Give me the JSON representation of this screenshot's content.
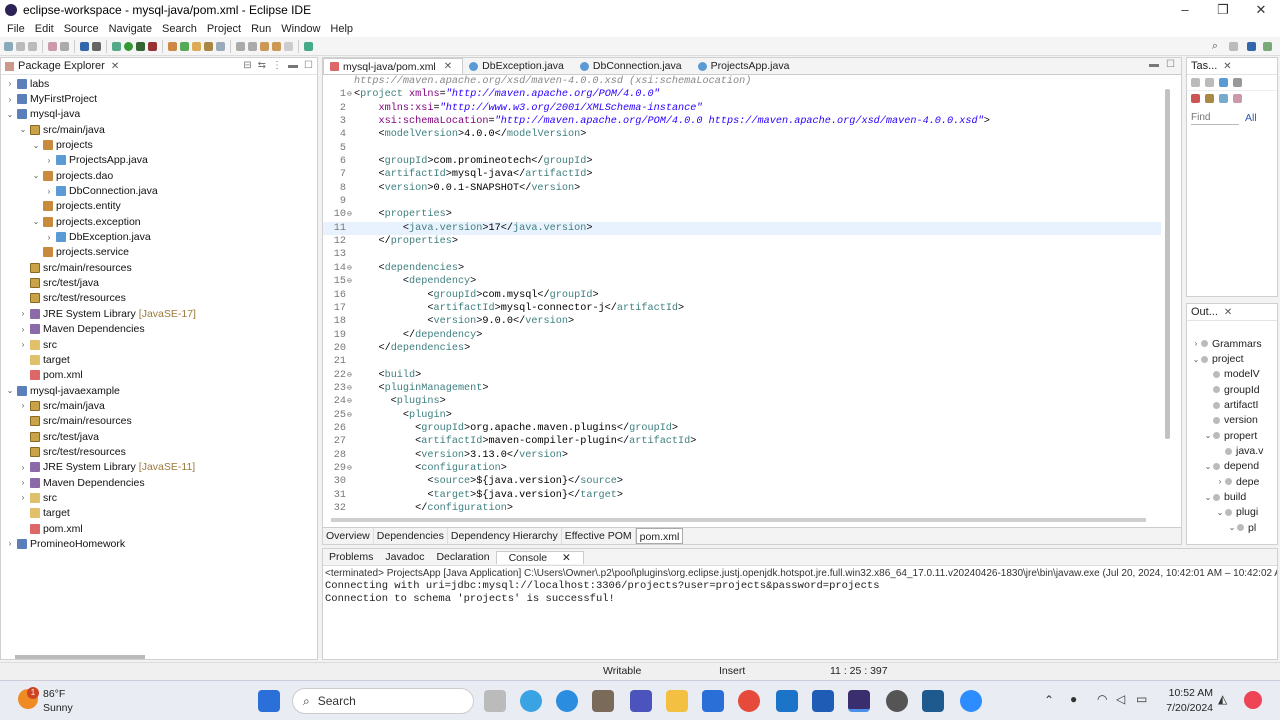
{
  "window": {
    "title": "eclipse-workspace - mysql-java/pom.xml - Eclipse IDE",
    "buttons": [
      "–",
      "❐",
      "✕"
    ]
  },
  "menu": [
    "File",
    "Edit",
    "Source",
    "Navigate",
    "Search",
    "Project",
    "Run",
    "Window",
    "Help"
  ],
  "explorer": {
    "title": "Package Explorer",
    "items": [
      {
        "label": "labs",
        "depth": 0,
        "expand": ">",
        "icon": "project"
      },
      {
        "label": "MyFirstProject",
        "depth": 0,
        "expand": ">",
        "icon": "project"
      },
      {
        "label": "mysql-java",
        "depth": 0,
        "expand": "v",
        "icon": "project"
      },
      {
        "label": "src/main/java",
        "depth": 1,
        "expand": "v",
        "icon": "src-folder"
      },
      {
        "label": "projects",
        "depth": 2,
        "expand": "v",
        "icon": "package"
      },
      {
        "label": "ProjectsApp.java",
        "depth": 3,
        "expand": ">",
        "icon": "java-file"
      },
      {
        "label": "projects.dao",
        "depth": 2,
        "expand": "v",
        "icon": "package"
      },
      {
        "label": "DbConnection.java",
        "depth": 3,
        "expand": ">",
        "icon": "java-file"
      },
      {
        "label": "projects.entity",
        "depth": 2,
        "expand": "",
        "icon": "package"
      },
      {
        "label": "projects.exception",
        "depth": 2,
        "expand": "v",
        "icon": "package"
      },
      {
        "label": "DbException.java",
        "depth": 3,
        "expand": ">",
        "icon": "java-file"
      },
      {
        "label": "projects.service",
        "depth": 2,
        "expand": "",
        "icon": "package"
      },
      {
        "label": "src/main/resources",
        "depth": 1,
        "expand": "",
        "icon": "src-folder"
      },
      {
        "label": "src/test/java",
        "depth": 1,
        "expand": "",
        "icon": "src-folder"
      },
      {
        "label": "src/test/resources",
        "depth": 1,
        "expand": "",
        "icon": "src-folder"
      },
      {
        "label": "JRE System Library",
        "decor": "[JavaSE-17]",
        "depth": 1,
        "expand": ">",
        "icon": "library"
      },
      {
        "label": "Maven Dependencies",
        "depth": 1,
        "expand": ">",
        "icon": "library"
      },
      {
        "label": "src",
        "depth": 1,
        "expand": ">",
        "icon": "folder"
      },
      {
        "label": "target",
        "depth": 1,
        "expand": "",
        "icon": "folder"
      },
      {
        "label": "pom.xml",
        "depth": 1,
        "expand": "",
        "icon": "xml-file"
      },
      {
        "label": "mysql-javaexample",
        "depth": 0,
        "expand": "v",
        "icon": "project"
      },
      {
        "label": "src/main/java",
        "depth": 1,
        "expand": ">",
        "icon": "src-folder"
      },
      {
        "label": "src/main/resources",
        "depth": 1,
        "expand": "",
        "icon": "src-folder"
      },
      {
        "label": "src/test/java",
        "depth": 1,
        "expand": "",
        "icon": "src-folder"
      },
      {
        "label": "src/test/resources",
        "depth": 1,
        "expand": "",
        "icon": "src-folder"
      },
      {
        "label": "JRE System Library",
        "decor": "[JavaSE-11]",
        "depth": 1,
        "expand": ">",
        "icon": "library"
      },
      {
        "label": "Maven Dependencies",
        "depth": 1,
        "expand": ">",
        "icon": "library"
      },
      {
        "label": "src",
        "depth": 1,
        "expand": ">",
        "icon": "folder"
      },
      {
        "label": "target",
        "depth": 1,
        "expand": "",
        "icon": "folder"
      },
      {
        "label": "pom.xml",
        "depth": 1,
        "expand": "",
        "icon": "xml-file"
      },
      {
        "label": "PromineoHomework",
        "depth": 0,
        "expand": ">",
        "icon": "project"
      }
    ]
  },
  "editor": {
    "tabs": [
      {
        "label": "mysql-java/pom.xml",
        "active": true
      },
      {
        "label": "DbException.java",
        "active": false
      },
      {
        "label": "DbConnection.java",
        "active": false
      },
      {
        "label": "ProjectsApp.java",
        "active": false
      }
    ],
    "hover_line": "https://maven.apache.org/xsd/maven-4.0.0.xsd (xsi:schemaLocation)",
    "lines": [
      {
        "n": "1",
        "f": "⊖",
        "t": "<project xmlns=\"http://maven.apache.org/POM/4.0.0\""
      },
      {
        "n": "2",
        "f": "",
        "t": "    xmlns:xsi=\"http://www.w3.org/2001/XMLSchema-instance\""
      },
      {
        "n": "3",
        "f": "",
        "t": "    xsi:schemaLocation=\"http://maven.apache.org/POM/4.0.0 https://maven.apache.org/xsd/maven-4.0.0.xsd\">"
      },
      {
        "n": "4",
        "f": "",
        "t": "    <modelVersion>4.0.0</modelVersion>"
      },
      {
        "n": "5",
        "f": "",
        "t": ""
      },
      {
        "n": "6",
        "f": "",
        "t": "    <groupId>com.promineotech</groupId>"
      },
      {
        "n": "7",
        "f": "",
        "t": "    <artifactId>mysql-java</artifactId>"
      },
      {
        "n": "8",
        "f": "",
        "t": "    <version>0.0.1-SNAPSHOT</version>"
      },
      {
        "n": "9",
        "f": "",
        "t": ""
      },
      {
        "n": "10",
        "f": "⊖",
        "t": "    <properties>"
      },
      {
        "n": "11",
        "f": "",
        "t": "        <java.version>17</java.version>"
      },
      {
        "n": "12",
        "f": "",
        "t": "    </properties>"
      },
      {
        "n": "13",
        "f": "",
        "t": ""
      },
      {
        "n": "14",
        "f": "⊖",
        "t": "    <dependencies>"
      },
      {
        "n": "15",
        "f": "⊖",
        "t": "        <dependency>"
      },
      {
        "n": "16",
        "f": "",
        "t": "            <groupId>com.mysql</groupId>"
      },
      {
        "n": "17",
        "f": "",
        "t": "            <artifactId>mysql-connector-j</artifactId>"
      },
      {
        "n": "18",
        "f": "",
        "t": "            <version>9.0.0</version>"
      },
      {
        "n": "19",
        "f": "",
        "t": "        </dependency>"
      },
      {
        "n": "20",
        "f": "",
        "t": "    </dependencies>"
      },
      {
        "n": "21",
        "f": "",
        "t": ""
      },
      {
        "n": "22",
        "f": "⊖",
        "t": "    <build>"
      },
      {
        "n": "23",
        "f": "⊖",
        "t": "    <pluginManagement>"
      },
      {
        "n": "24",
        "f": "⊖",
        "t": "      <plugins>"
      },
      {
        "n": "25",
        "f": "⊖",
        "t": "        <plugin>"
      },
      {
        "n": "26",
        "f": "",
        "t": "          <groupId>org.apache.maven.plugins</groupId>"
      },
      {
        "n": "27",
        "f": "",
        "t": "          <artifactId>maven-compiler-plugin</artifactId>"
      },
      {
        "n": "28",
        "f": "",
        "t": "          <version>3.13.0</version>"
      },
      {
        "n": "29",
        "f": "⊖",
        "t": "          <configuration>"
      },
      {
        "n": "30",
        "f": "",
        "t": "            <source>${java.version}</source>"
      },
      {
        "n": "31",
        "f": "",
        "t": "            <target>${java.version}</target>"
      },
      {
        "n": "32",
        "f": "",
        "t": "          </configuration>"
      }
    ],
    "current_line": "11",
    "pom_tabs": [
      "Overview",
      "Dependencies",
      "Dependency Hierarchy",
      "Effective POM",
      "pom.xml"
    ],
    "active_pom_tab": "pom.xml"
  },
  "tasks": {
    "title": "Tas...",
    "find_placeholder": "Find",
    "all_label": "All"
  },
  "outline": {
    "title": "Out...",
    "items": [
      {
        "label": "Grammars",
        "depth": 0,
        "expand": ">"
      },
      {
        "label": "project",
        "depth": 0,
        "expand": "v"
      },
      {
        "label": "modelV",
        "depth": 1,
        "expand": ""
      },
      {
        "label": "groupId",
        "depth": 1,
        "expand": ""
      },
      {
        "label": "artifactI",
        "depth": 1,
        "expand": ""
      },
      {
        "label": "version",
        "depth": 1,
        "expand": ""
      },
      {
        "label": "propert",
        "depth": 1,
        "expand": "v"
      },
      {
        "label": "java.v",
        "depth": 2,
        "expand": ""
      },
      {
        "label": "depend",
        "depth": 1,
        "expand": "v"
      },
      {
        "label": "depe",
        "depth": 2,
        "expand": ">"
      },
      {
        "label": "build",
        "depth": 1,
        "expand": "v"
      },
      {
        "label": "plugi",
        "depth": 2,
        "expand": "v"
      },
      {
        "label": "pl",
        "depth": 3,
        "expand": "v"
      }
    ]
  },
  "console": {
    "tabs": [
      "Problems",
      "Javadoc",
      "Declaration",
      "Console"
    ],
    "active_tab": "Console",
    "terminated": "<terminated> ProjectsApp [Java Application] C:\\Users\\Owner\\.p2\\pool\\plugins\\org.eclipse.justj.openjdk.hotspot.jre.full.win32.x86_64_17.0.11.v20240426-1830\\jre\\bin\\javaw.exe  (Jul 20, 2024, 10:42:01 AM – 10:42:02 AM",
    "output": [
      "Connecting with uri=jdbc:mysql://localhost:3306/projects?user=projects&password=projects",
      "Connection to schema 'projects' is successful!"
    ]
  },
  "status": {
    "writable": "Writable",
    "insert": "Insert",
    "position": "11 : 25 : 397"
  },
  "taskbar": {
    "weather_temp": "86°F",
    "weather_desc": "Sunny",
    "weather_badge": "1",
    "search_placeholder": "Search",
    "time": "10:52 AM",
    "date": "7/20/2024"
  },
  "colors": {
    "tag": "#3f7f7f",
    "attr": "#7f007f",
    "value": "#2a00ff",
    "current_line": "#e8f2fe"
  }
}
